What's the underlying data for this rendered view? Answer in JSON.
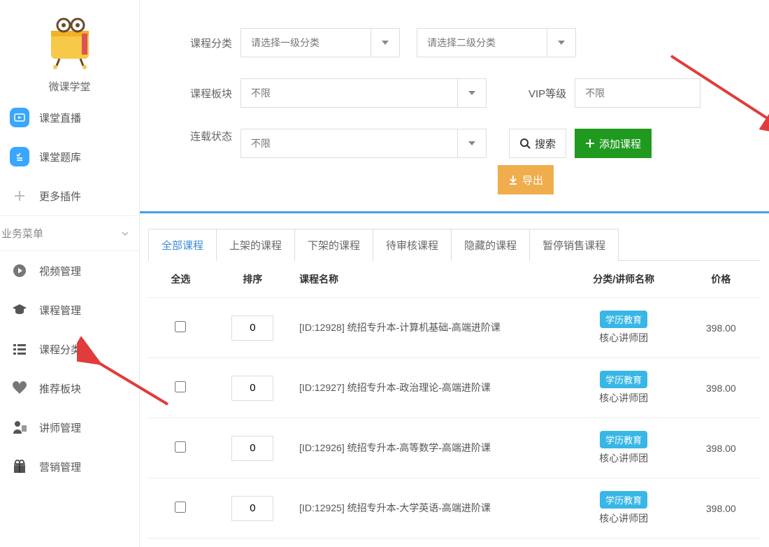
{
  "brand": {
    "name": "微课学堂"
  },
  "sidebar": {
    "top_items": [
      {
        "label": "课堂直播"
      },
      {
        "label": "课堂题库"
      },
      {
        "label": "更多插件"
      }
    ],
    "section_title": "业务菜单",
    "biz_items": [
      {
        "label": "视频管理"
      },
      {
        "label": "课程管理"
      },
      {
        "label": "课程分类"
      },
      {
        "label": "推荐板块"
      },
      {
        "label": "讲师管理"
      },
      {
        "label": "营销管理"
      }
    ]
  },
  "filters": {
    "category_label": "课程分类",
    "category1_placeholder": "请选择一级分类",
    "category2_placeholder": "请选择二级分类",
    "board_label": "课程板块",
    "board_value": "不限",
    "vip_label": "VIP等级",
    "vip_value": "不限",
    "serial_label": "连载状态",
    "serial_value": "不限",
    "search_btn": "搜索",
    "add_btn": "添加课程",
    "export_btn": "导出"
  },
  "tabs": [
    "全部课程",
    "上架的课程",
    "下架的课程",
    "待审核课程",
    "隐藏的课程",
    "暂停销售课程"
  ],
  "table": {
    "headers": {
      "select": "全选",
      "sort": "排序",
      "name": "课程名称",
      "category": "分类/讲师名称",
      "price": "价格"
    },
    "rows": [
      {
        "sort": "0",
        "name": "[ID:12928] 统招专升本-计算机基础-高端进阶课",
        "badge": "学历教育",
        "teacher": "核心讲师团",
        "price": "398.00"
      },
      {
        "sort": "0",
        "name": "[ID:12927] 统招专升本-政治理论-高端进阶课",
        "badge": "学历教育",
        "teacher": "核心讲师团",
        "price": "398.00"
      },
      {
        "sort": "0",
        "name": "[ID:12926] 统招专升本-高等数学-高端进阶课",
        "badge": "学历教育",
        "teacher": "核心讲师团",
        "price": "398.00"
      },
      {
        "sort": "0",
        "name": "[ID:12925] 统招专升本-大学英语-高端进阶课",
        "badge": "学历教育",
        "teacher": "核心讲师团",
        "price": "398.00"
      }
    ]
  }
}
